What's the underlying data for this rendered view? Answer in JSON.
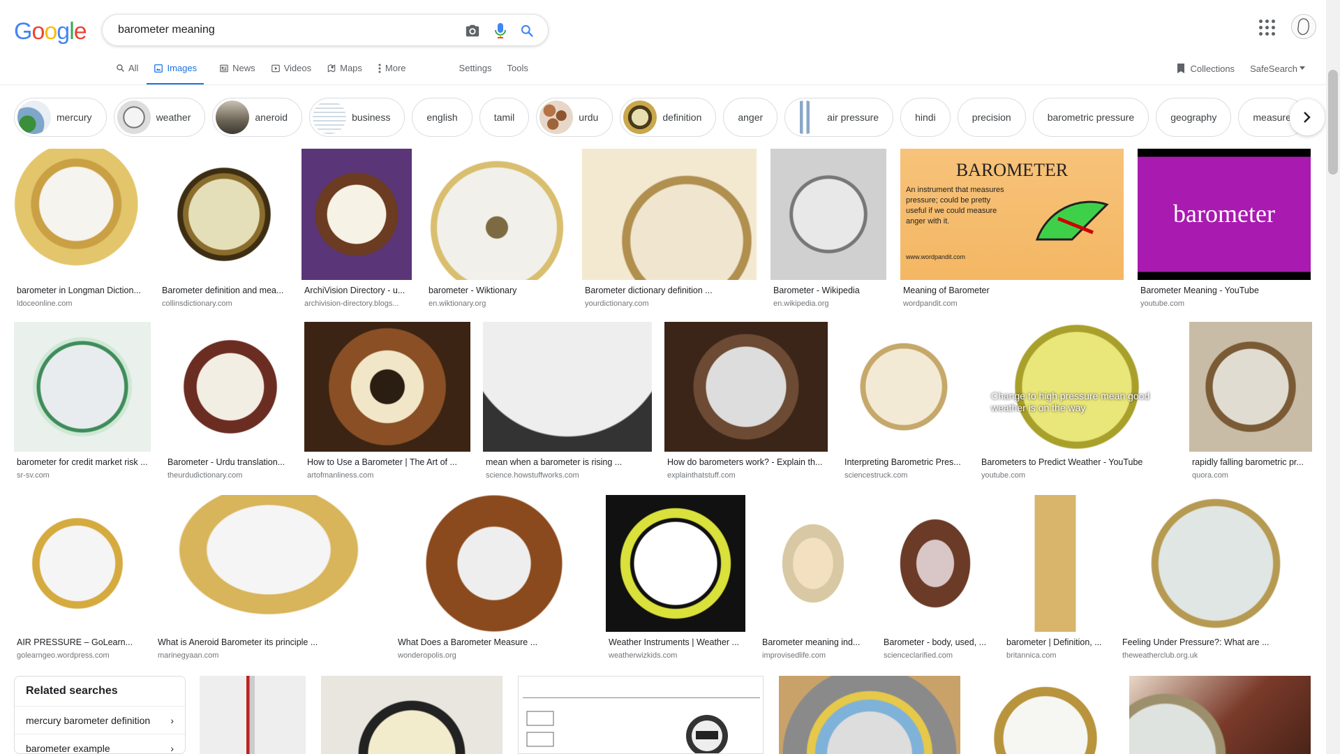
{
  "search": {
    "query": "barometer meaning"
  },
  "tabs": [
    {
      "label": "All",
      "icon": "search-icon"
    },
    {
      "label": "Images",
      "icon": "image-icon",
      "active": true
    },
    {
      "label": "News",
      "icon": "news-icon"
    },
    {
      "label": "Videos",
      "icon": "play-icon"
    },
    {
      "label": "Maps",
      "icon": "map-icon"
    },
    {
      "label": "More",
      "icon": "more-vert-icon"
    },
    {
      "label": "Settings"
    },
    {
      "label": "Tools"
    }
  ],
  "right_tools": {
    "collections": "Collections",
    "safesearch": "SafeSearch"
  },
  "chips": [
    "mercury",
    "weather",
    "aneroid",
    "business",
    "english",
    "tamil",
    "urdu",
    "definition",
    "anger",
    "air pressure",
    "hindi",
    "precision",
    "barometric pressure",
    "geography",
    "measure"
  ],
  "results": [
    {
      "caption": "barometer in Longman Diction...",
      "source": "ldoceonline.com"
    },
    {
      "caption": "Barometer definition and mea...",
      "source": "collinsdictionary.com"
    },
    {
      "caption": "ArchiVision Directory - u...",
      "source": "archivision-directory.blogs..."
    },
    {
      "caption": "barometer - Wiktionary",
      "source": "en.wiktionary.org"
    },
    {
      "caption": "Barometer dictionary definition ...",
      "source": "yourdictionary.com"
    },
    {
      "caption": "Barometer - Wikipedia",
      "source": "en.wikipedia.org"
    },
    {
      "caption": "Meaning of Barometer",
      "source": "wordpandit.com"
    },
    {
      "caption": "Barometer Meaning - YouTube",
      "source": "youtube.com"
    },
    {
      "caption": "barometer for credit market risk ...",
      "source": "sr-sv.com"
    },
    {
      "caption": "Barometer - Urdu translation...",
      "source": "theurdudictionary.com"
    },
    {
      "caption": "How to Use a Barometer | The Art of ...",
      "source": "artofmanliness.com"
    },
    {
      "caption": "mean when a barometer is rising ...",
      "source": "science.howstuffworks.com"
    },
    {
      "caption": "How do barometers work? - Explain th...",
      "source": "explainthatstuff.com"
    },
    {
      "caption": "Interpreting Barometric Pres...",
      "source": "sciencestruck.com"
    },
    {
      "caption": "Barometers to Predict Weather - YouTube",
      "source": "youtube.com"
    },
    {
      "caption": "rapidly falling barometric pr...",
      "source": "quora.com"
    },
    {
      "caption": "AIR PRESSURE – GoLearn...",
      "source": "golearngeo.wordpress.com"
    },
    {
      "caption": "What is Aneroid Barometer its principle ...",
      "source": "marinegyaan.com"
    },
    {
      "caption": "What Does a Barometer Measure ...",
      "source": "wonderopolis.org"
    },
    {
      "caption": "Weather Instruments | Weather ...",
      "source": "weatherwizkids.com"
    },
    {
      "caption": "Barometer meaning ind...",
      "source": "improvisedlife.com"
    },
    {
      "caption": "Barometer - body, used, ...",
      "source": "scienceclarified.com"
    },
    {
      "caption": "barometer | Definition, ...",
      "source": "britannica.com"
    },
    {
      "caption": "Feeling Under Pressure?: What are ...",
      "source": "theweatherclub.org.uk"
    }
  ],
  "thumb_text": {
    "wordpandit_title": "BAROMETER",
    "wordpandit_text": "An instrument that measures pressure; could be pretty useful if we could measure anger with it.",
    "wordpandit_site": "www.wordpandit.com",
    "youtube_title": "barometer",
    "youtube2_text": "Change to high pressure mean good weather is on the way"
  },
  "related": {
    "title": "Related searches",
    "items": [
      "mercury barometer definition",
      "barometer example"
    ]
  },
  "colors": {
    "accent": "#1a73e8",
    "text": "#202124",
    "muted": "#70757a"
  }
}
